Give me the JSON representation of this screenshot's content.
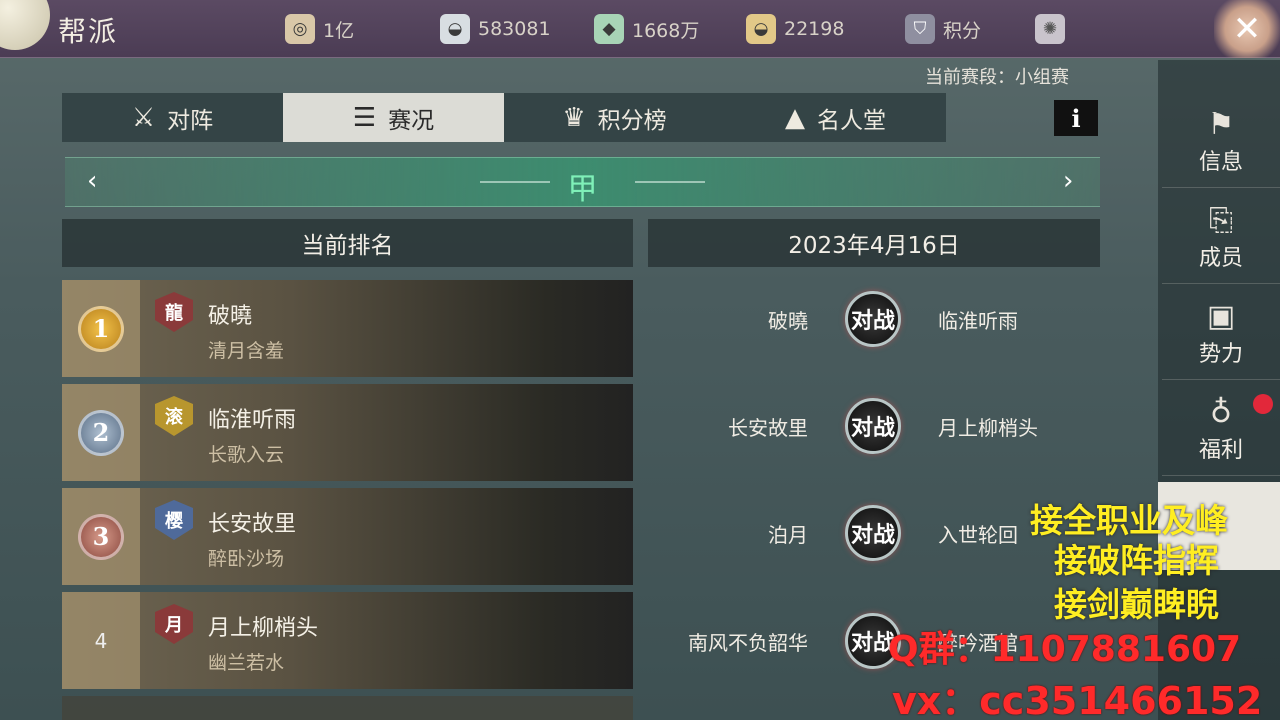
{
  "header": {
    "title": "帮派",
    "currencies": [
      {
        "icon": "coin-bag-icon",
        "value": "1亿"
      },
      {
        "icon": "silver-ingot-icon",
        "value": "583081"
      },
      {
        "icon": "jade-icon",
        "value": "1668万"
      },
      {
        "icon": "gold-ingot-icon",
        "value": "22198"
      }
    ],
    "points_label": "积分",
    "close_label": "✕"
  },
  "season": {
    "label": "当前赛段：小组赛"
  },
  "tabs": [
    {
      "label": "对阵",
      "icon": "crossed-swords-icon",
      "active": false
    },
    {
      "label": "赛况",
      "icon": "document-icon",
      "active": true
    },
    {
      "label": "积分榜",
      "icon": "trophy-icon",
      "active": false
    },
    {
      "label": "名人堂",
      "icon": "podium-icon",
      "active": false
    }
  ],
  "info_label": "i",
  "group": {
    "name": "甲"
  },
  "ranking": {
    "header": "当前排名",
    "rows": [
      {
        "rank": "1",
        "badge": "龍",
        "name": "破曉",
        "sub": "清月含羞"
      },
      {
        "rank": "2",
        "badge": "滚",
        "name": "临淮听雨",
        "sub": "长歌入云"
      },
      {
        "rank": "3",
        "badge": "樱",
        "name": "长安故里",
        "sub": "醉卧沙场"
      },
      {
        "rank": "4",
        "badge": "月",
        "name": "月上柳梢头",
        "sub": "幽兰若水"
      }
    ]
  },
  "matches": {
    "date": "2023年4月16日",
    "vs_label": "对战",
    "rows": [
      {
        "left": "破曉",
        "right": "临淮听雨"
      },
      {
        "left": "长安故里",
        "right": "月上柳梢头"
      },
      {
        "left": "泊月",
        "right": "入世轮回"
      },
      {
        "left": "南风不负韶华",
        "right": "醉吟酒馆"
      }
    ]
  },
  "sidebar": [
    {
      "label": "信息",
      "icon": "flag-icon"
    },
    {
      "label": "成员",
      "icon": "scroll-icon"
    },
    {
      "label": "势力",
      "icon": "banner-icon"
    },
    {
      "label": "福利",
      "icon": "money-bag-icon"
    }
  ],
  "watermark": {
    "lines": [
      "接全职业及峰",
      "接破阵指挥",
      "接剑巅睥睨"
    ],
    "qq": "Q群：1107881607",
    "vx": "vx：cc351466152"
  },
  "colors": {
    "accent_green": "#7ff0b8",
    "watermark_yellow": "#ffee22",
    "watermark_red": "#ff2a2a",
    "notify_red": "#e2283a"
  }
}
